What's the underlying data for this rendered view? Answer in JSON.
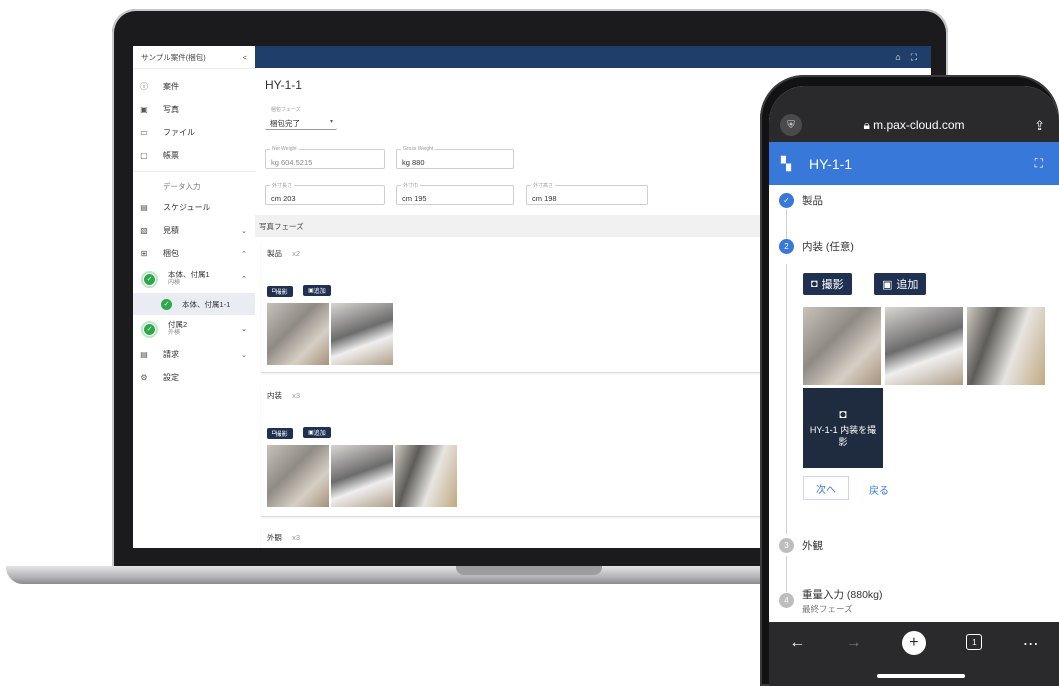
{
  "laptop": {
    "sidebar": {
      "title": "サンプル案件(梱包)",
      "collapse": "<",
      "items": [
        {
          "label": "案件",
          "icon": "info-icon"
        },
        {
          "label": "写真",
          "icon": "image-icon"
        },
        {
          "label": "ファイル",
          "icon": "folder-icon"
        },
        {
          "label": "帳票",
          "icon": "document-icon"
        }
      ],
      "section_label": "データ入力",
      "schedule": "スケジュール",
      "estimate": "見積",
      "packing": "梱包",
      "node1": {
        "title": "本体、付属1",
        "sub": "内検"
      },
      "node1_child": "本体、付属1-1",
      "node2": {
        "title": "付属2",
        "sub": "外検"
      },
      "billing": "請求",
      "settings": "設定"
    },
    "main": {
      "title": "HY-1-1",
      "phase_label": "梱包フェーズ",
      "phase_value": "梱包完了",
      "net_weight": {
        "label": "Net Weight",
        "unit": "kg",
        "value": "604.5215"
      },
      "gross_weight": {
        "label": "Gross Weight",
        "unit": "kg",
        "value": "880"
      },
      "length": {
        "label": "外寸長さ",
        "unit": "cm",
        "value": "203"
      },
      "width": {
        "label": "外寸巾",
        "unit": "cm",
        "value": "195"
      },
      "height": {
        "label": "外寸高さ",
        "unit": "cm",
        "value": "198"
      },
      "photo_phase": "写真フェーズ",
      "cards": [
        {
          "title": "製品",
          "count": "x2"
        },
        {
          "title": "内装",
          "count": "x3"
        },
        {
          "title": "外観",
          "count": "x3"
        }
      ],
      "shoot_label": "撮影",
      "add_label": "追加"
    }
  },
  "phone": {
    "url": "m.pax-cloud.com",
    "header_title": "HY-1-1",
    "step1": "製品",
    "step2": "内装 (任意)",
    "step2_num": "2",
    "shoot_label": "撮影",
    "add_label": "追加",
    "capture_text": "HY-1-1 内装を撮影",
    "next": "次へ",
    "back": "戻る",
    "step3": "外観",
    "step3_num": "3",
    "step4": "重量入力 (880kg)",
    "step4_sub": "最終フェーズ",
    "step4_num": "4",
    "tab_count": "1"
  }
}
